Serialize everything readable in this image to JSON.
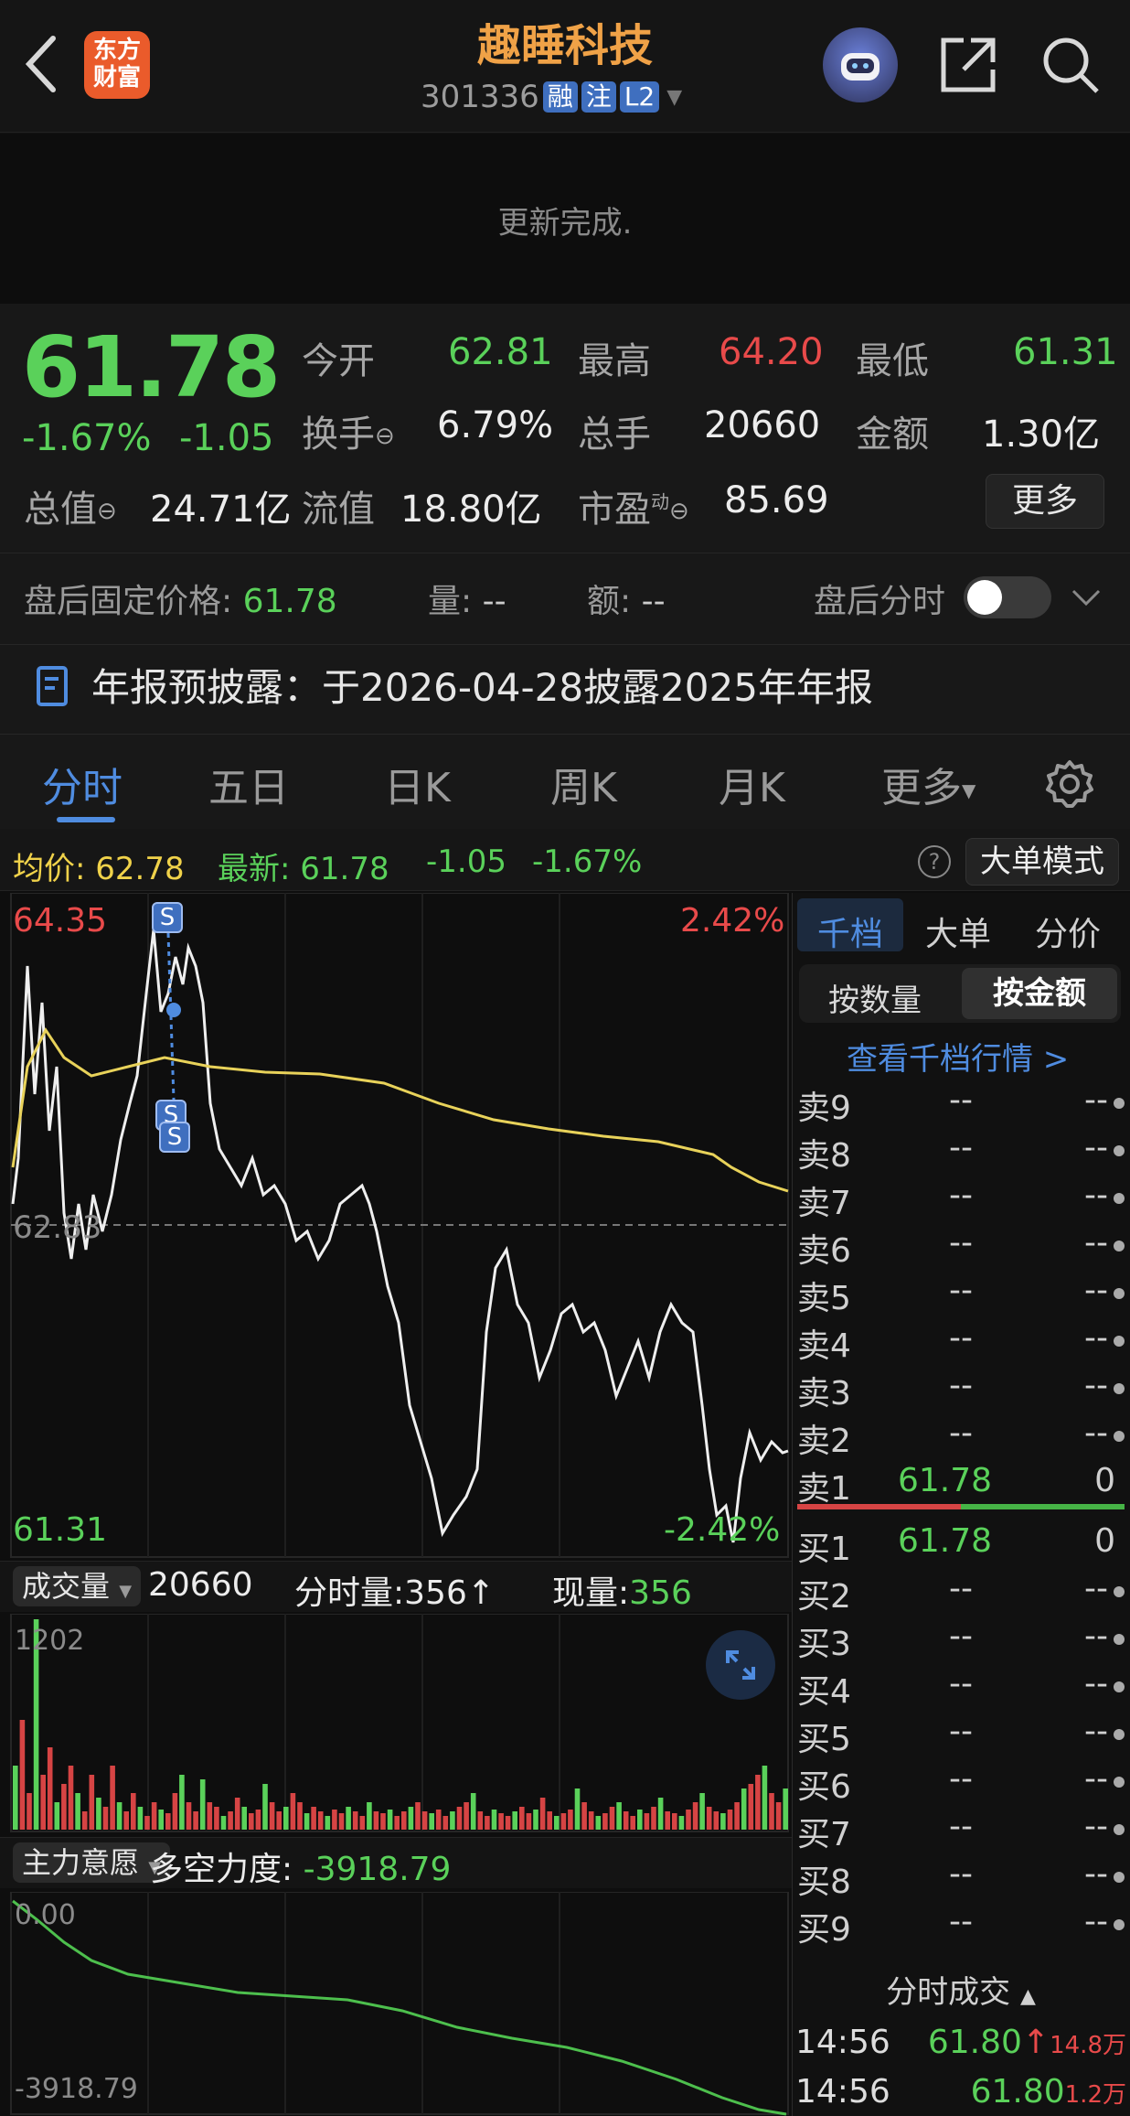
{
  "header": {
    "back_icon": "chevron-left-icon",
    "logo_text": "东方\n财富",
    "logo_line1": "东方",
    "logo_line2": "财富",
    "title": "趣睡科技",
    "code": "301336",
    "badges": [
      "融",
      "注",
      "L2"
    ],
    "robot_icon": "robot-avatar-icon",
    "share_icon": "share-icon",
    "search_icon": "search-icon"
  },
  "banner": {
    "text": "更新完成."
  },
  "quote": {
    "price": "61.78",
    "change_pct": "-1.67%",
    "change": "-1.05",
    "open_label": "今开",
    "open": "62.81",
    "high_label": "最高",
    "high": "64.20",
    "low_label": "最低",
    "low": "61.31",
    "turnover_label": "换手",
    "turnover": "6.79%",
    "volume_label": "总手",
    "volume": "20660",
    "amount_label": "金额",
    "amount": "1.30亿",
    "mktcap_label": "总值",
    "mktcap": "24.71亿",
    "float_label": "流值",
    "float": "18.80亿",
    "pe_label": "市盈",
    "pe_sup": "动",
    "pe": "85.69",
    "more_button": "更多"
  },
  "afterhours": {
    "price_label": "盘后固定价格:",
    "price": "61.78",
    "qty_label": "量:",
    "qty": "--",
    "amt_label": "额:",
    "amt": "--",
    "timeshare_label": "盘后分时",
    "toggle_on": false
  },
  "notice": {
    "text": "年报预披露：于2026-04-28披露2025年年报"
  },
  "tabs": {
    "items": [
      "分时",
      "五日",
      "日K",
      "周K",
      "月K",
      "更多"
    ],
    "active": 0,
    "settings_icon": "gear-icon"
  },
  "intraday_bar": {
    "avg_label": "均价:",
    "avg": "62.78",
    "latest_label": "最新:",
    "latest": "61.78",
    "change": "-1.05",
    "change_pct": "-1.67%",
    "help_icon": "question-icon",
    "mode_button": "大单模式"
  },
  "price_chart": {
    "y_high": "64.35",
    "y_low": "61.31",
    "y_mid": "62.83",
    "pct_high": "2.42%",
    "pct_low": "-2.42%",
    "markers": [
      "S",
      "S",
      "S"
    ]
  },
  "volume_bar": {
    "selector": "成交量",
    "total": "20660",
    "minute_label": "分时量:",
    "minute": "356↑",
    "now_label": "现量:",
    "now": "356",
    "y_max": "1202",
    "expand_icon": "expand-arrows-icon"
  },
  "force_bar": {
    "selector": "主力意愿",
    "label": "多空力度:",
    "value": "-3918.79",
    "y_top": "0.00",
    "y_bottom": "-3918.79"
  },
  "orderbook": {
    "tabs": [
      "千档",
      "大单",
      "分价"
    ],
    "active_tab": 0,
    "toggle": [
      "按数量",
      "按金额"
    ],
    "active_toggle": 1,
    "link": "查看千档行情 >",
    "sells": [
      {
        "label": "卖9",
        "price": "--",
        "qty": "--"
      },
      {
        "label": "卖8",
        "price": "--",
        "qty": "--"
      },
      {
        "label": "卖7",
        "price": "--",
        "qty": "--"
      },
      {
        "label": "卖6",
        "price": "--",
        "qty": "--"
      },
      {
        "label": "卖5",
        "price": "--",
        "qty": "--"
      },
      {
        "label": "卖4",
        "price": "--",
        "qty": "--"
      },
      {
        "label": "卖3",
        "price": "--",
        "qty": "--"
      },
      {
        "label": "卖2",
        "price": "--",
        "qty": "--"
      },
      {
        "label": "卖1",
        "price": "61.78",
        "qty": "0"
      }
    ],
    "buys": [
      {
        "label": "买1",
        "price": "61.78",
        "qty": "0"
      },
      {
        "label": "买2",
        "price": "--",
        "qty": "--"
      },
      {
        "label": "买3",
        "price": "--",
        "qty": "--"
      },
      {
        "label": "买4",
        "price": "--",
        "qty": "--"
      },
      {
        "label": "买5",
        "price": "--",
        "qty": "--"
      },
      {
        "label": "买6",
        "price": "--",
        "qty": "--"
      },
      {
        "label": "买7",
        "price": "--",
        "qty": "--"
      },
      {
        "label": "买8",
        "price": "--",
        "qty": "--"
      },
      {
        "label": "买9",
        "price": "--",
        "qty": "--"
      }
    ],
    "trades_header": "分时成交",
    "trades": [
      {
        "time": "14:56",
        "price": "61.80",
        "arrow": "↑",
        "amount": "14.8万"
      },
      {
        "time": "14:56",
        "price": "61.80",
        "arrow": "",
        "amount": "1.2万"
      }
    ]
  },
  "colors": {
    "up": "#e84a4a",
    "down": "#5ad15a",
    "avg_line": "#e8d25a",
    "accent": "#4f8ce0"
  }
}
